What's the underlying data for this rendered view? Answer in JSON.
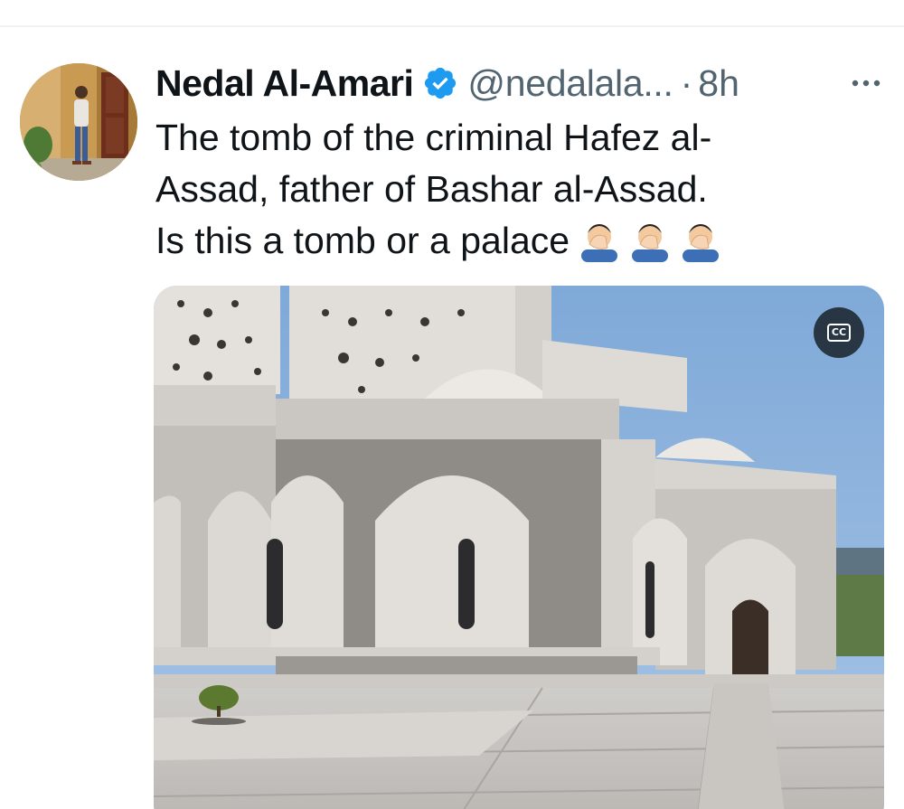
{
  "tweet": {
    "author": {
      "display_name": "Nedal Al-Amari",
      "handle": "@nedalala...",
      "verified_icon": "verified-badge-icon",
      "avatar": "profile-photo"
    },
    "separator": "·",
    "time": "8h",
    "more_icon": "more-horizontal-icon",
    "text_lines": [
      "The tomb of the criminal Hafez al-",
      "Assad, father of Bashar al-Assad.",
      "Is this a tomb or a palace"
    ],
    "emoji": [
      "face-palm-emoji",
      "face-palm-emoji",
      "face-palm-emoji"
    ],
    "media": {
      "kind": "video",
      "description_icon": "video-thumbnail",
      "captions_button": {
        "label": "CC",
        "icon": "closed-captions-icon"
      }
    }
  },
  "colors": {
    "text_primary": "#0f1419",
    "text_secondary": "#536471",
    "verified_blue": "#1d9bf0",
    "divider": "#eff3f4"
  }
}
